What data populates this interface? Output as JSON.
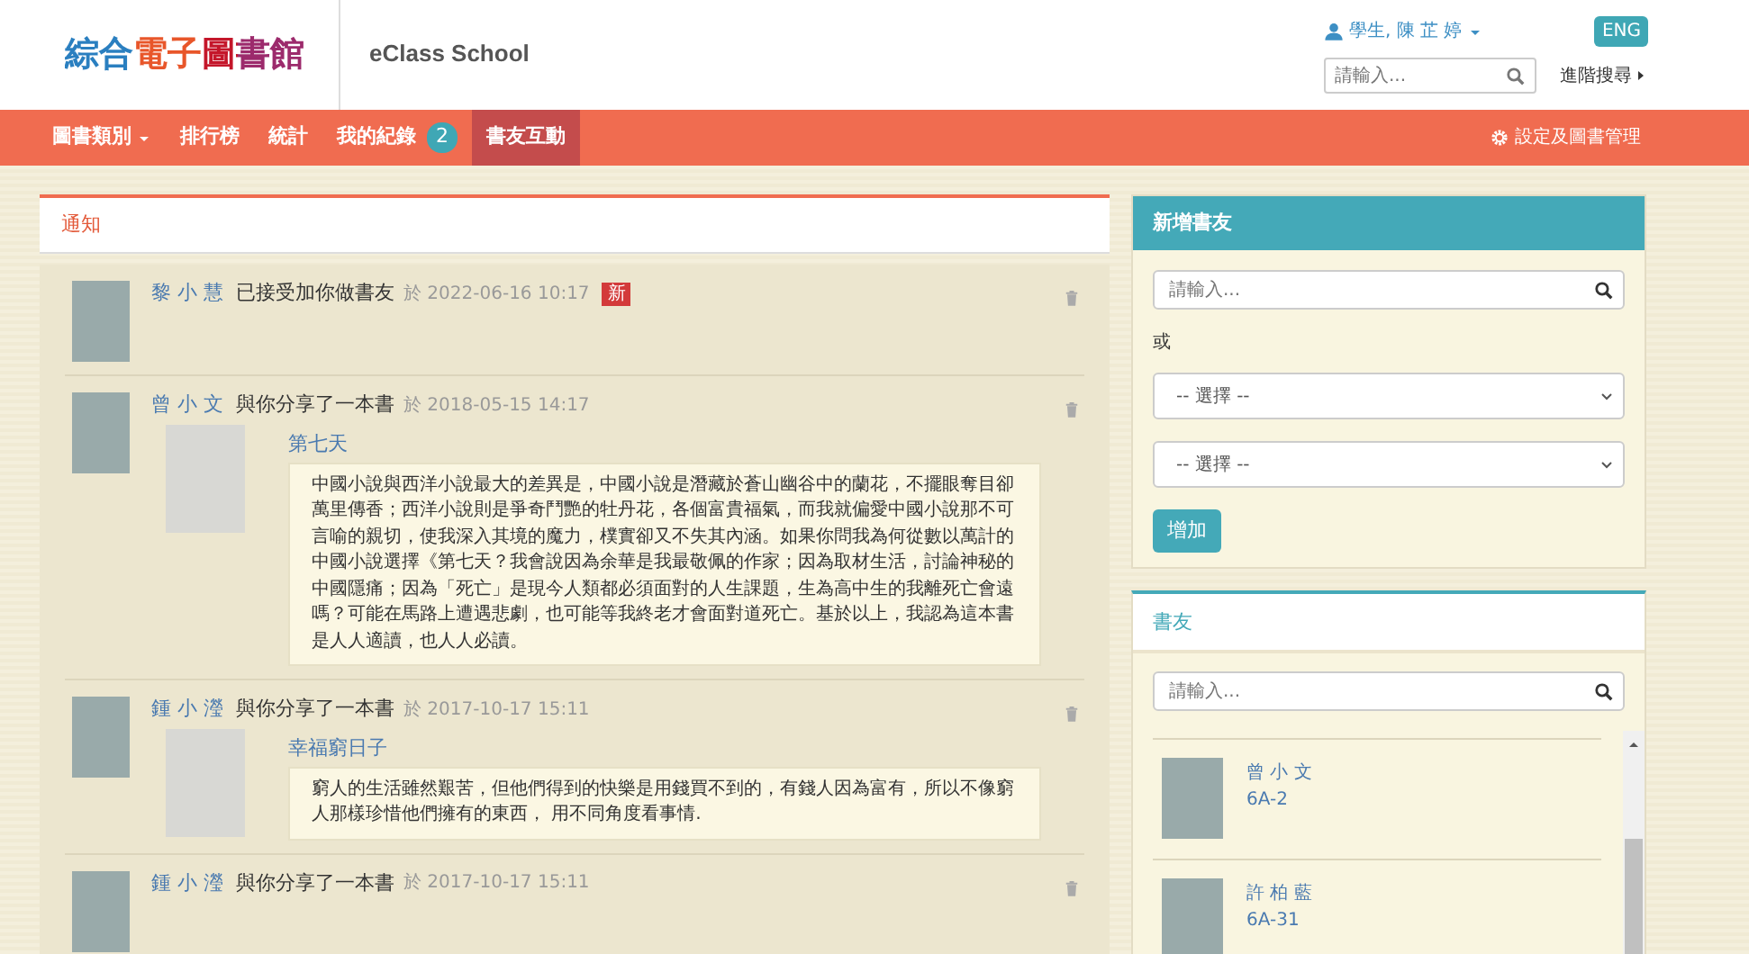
{
  "header": {
    "logo": "綜合電子圖書館",
    "school": "eClass School",
    "user": "學生, 陳 芷 婷",
    "language": "ENG",
    "search": {
      "placeholder": "請輸入..."
    },
    "advanced_search": "進階搜尋"
  },
  "nav": {
    "items": [
      {
        "label": "圖書類別",
        "dropdown": true,
        "selected": false
      },
      {
        "label": "排行榜",
        "selected": false
      },
      {
        "label": "統計",
        "selected": false
      },
      {
        "label": "我的紀錄",
        "badge": "2",
        "selected": false
      },
      {
        "label": "書友互動",
        "selected": true
      }
    ],
    "settings": "設定及圖書管理"
  },
  "notifications": {
    "title": "通知",
    "items": [
      {
        "name": "黎 小 慧",
        "action": "已接受加你做書友",
        "time": "於 2022-06-16 10:17",
        "badge": "新"
      },
      {
        "name": "曾 小 文",
        "action": "與你分享了一本書",
        "time": "於 2018-05-15 14:17",
        "book": {
          "title": "第七天",
          "review": "中國小說與西洋小說最大的差異是，中國小說是潛藏於蒼山幽谷中的蘭花，不擺眼奪目卻萬里傳香；西洋小說則是爭奇鬥艷的牡丹花，各個富貴福氣，而我就偏愛中國小說那不可言喻的親切，使我深入其境的魔力，樸實卻又不失其內涵。如果你問我為何從數以萬計的中國小說選擇《第七天？我會說因為余華是我最敬佩的作家；因為取材生活，討論神秘的中國隱痛；因為「死亡」是現今人類都必須面對的人生課題，生為高中生的我離死亡會遠嗎？可能在馬路上遭遇悲劇，也可能等我終老才會面對道死亡。基於以上，我認為這本書是人人適讀，也人人必讀。"
        }
      },
      {
        "name": "鍾 小 瀅",
        "action": "與你分享了一本書",
        "time": "於 2017-10-17 15:11",
        "book": {
          "title": "幸福窮日子",
          "review": "窮人的生活雖然艱苦，但他們得到的快樂是用錢買不到的，有錢人因為富有，所以不像窮人那樣珍惜他們擁有的東西， 用不同角度看事情."
        }
      },
      {
        "name": "鍾 小 瀅",
        "action": "與你分享了一本書",
        "time": "於 2017-10-17 15:11"
      }
    ]
  },
  "add_friend": {
    "title": "新增書友",
    "search": {
      "placeholder": "請輸入..."
    },
    "or": "或",
    "selects": [
      "-- 選擇 --",
      "-- 選擇 --"
    ],
    "button": "增加"
  },
  "friends": {
    "title": "書友",
    "search": {
      "placeholder": "請輸入..."
    },
    "items": [
      {
        "name": "曾 小 文",
        "class": "6A-2"
      },
      {
        "name": "許 柏 藍",
        "class": "6A-31"
      }
    ]
  }
}
